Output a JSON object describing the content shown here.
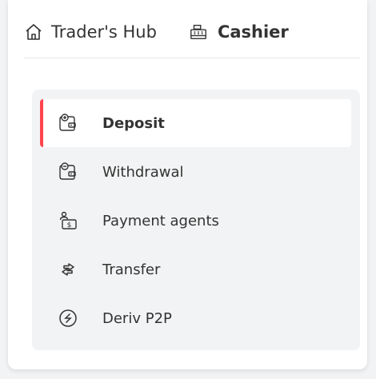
{
  "breadcrumb": {
    "home": {
      "label": "Trader's Hub",
      "icon": "home-icon"
    },
    "cashier": {
      "label": "Cashier",
      "icon": "cash-register-icon"
    }
  },
  "menu": {
    "accent_color": "#ff444f",
    "items": [
      {
        "label": "Deposit",
        "icon": "deposit-wallet-icon",
        "active": true
      },
      {
        "label": "Withdrawal",
        "icon": "withdrawal-wallet-icon",
        "active": false
      },
      {
        "label": "Payment agents",
        "icon": "payment-agent-icon",
        "active": false
      },
      {
        "label": "Transfer",
        "icon": "transfer-arrows-icon",
        "active": false
      },
      {
        "label": "Deriv P2P",
        "icon": "deriv-p2p-icon",
        "active": false
      }
    ]
  }
}
